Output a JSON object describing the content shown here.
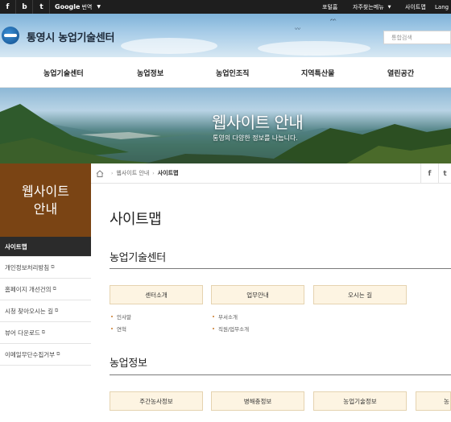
{
  "topbar": {
    "sns": [
      "f",
      "b",
      "t"
    ],
    "google_brand": "Google",
    "google_label": "번역",
    "links": [
      "포털홈",
      "자주찾는메뉴",
      "사이트맵",
      "Lang"
    ]
  },
  "header": {
    "site_title": "통영시 농업기술센터",
    "search_placeholder": "통합검색"
  },
  "gnb": [
    "농업기술센터",
    "농업정보",
    "농업인조직",
    "지역특산물",
    "열린공간"
  ],
  "visual": {
    "title": "웹사이트 안내",
    "subtitle": "통영의 다양한 정보를 나눕니다."
  },
  "lnb": {
    "title_line1": "웹사이트",
    "title_line2": "안내",
    "items": [
      {
        "label": "사이트맵",
        "active": true,
        "external": false
      },
      {
        "label": "개인정보처리방침",
        "active": false,
        "external": true
      },
      {
        "label": "홈페이지 개선건의",
        "active": false,
        "external": true
      },
      {
        "label": "시청 찾아오시는 길",
        "active": false,
        "external": true
      },
      {
        "label": "뷰어 다운로드",
        "active": false,
        "external": true
      },
      {
        "label": "이메일무단수집거부",
        "active": false,
        "external": true
      }
    ]
  },
  "breadcrumb": {
    "parent": "웹사이트 안내",
    "current": "사이트맵"
  },
  "share": [
    "f",
    "t"
  ],
  "content": {
    "page_title": "사이트맵",
    "sections": [
      {
        "title": "농업기술센터",
        "categories": [
          {
            "label": "센터소개",
            "subs": [
              "인사말",
              "연혁"
            ]
          },
          {
            "label": "업무안내",
            "subs": [
              "부서소개",
              "직원/업무소개"
            ]
          },
          {
            "label": "오시는 길",
            "subs": []
          }
        ]
      },
      {
        "title": "농업정보",
        "categories": [
          {
            "label": "주간농사정보",
            "subs": []
          },
          {
            "label": "병해충정보",
            "subs": []
          },
          {
            "label": "농업기술정보",
            "subs": []
          },
          {
            "label": "농",
            "subs": []
          }
        ]
      }
    ]
  },
  "colors": {
    "lnb_header": "#7a4414",
    "lnb_active": "#2b2b2b",
    "category_bg": "#fdf4e2",
    "bullet": "#c8792a"
  }
}
